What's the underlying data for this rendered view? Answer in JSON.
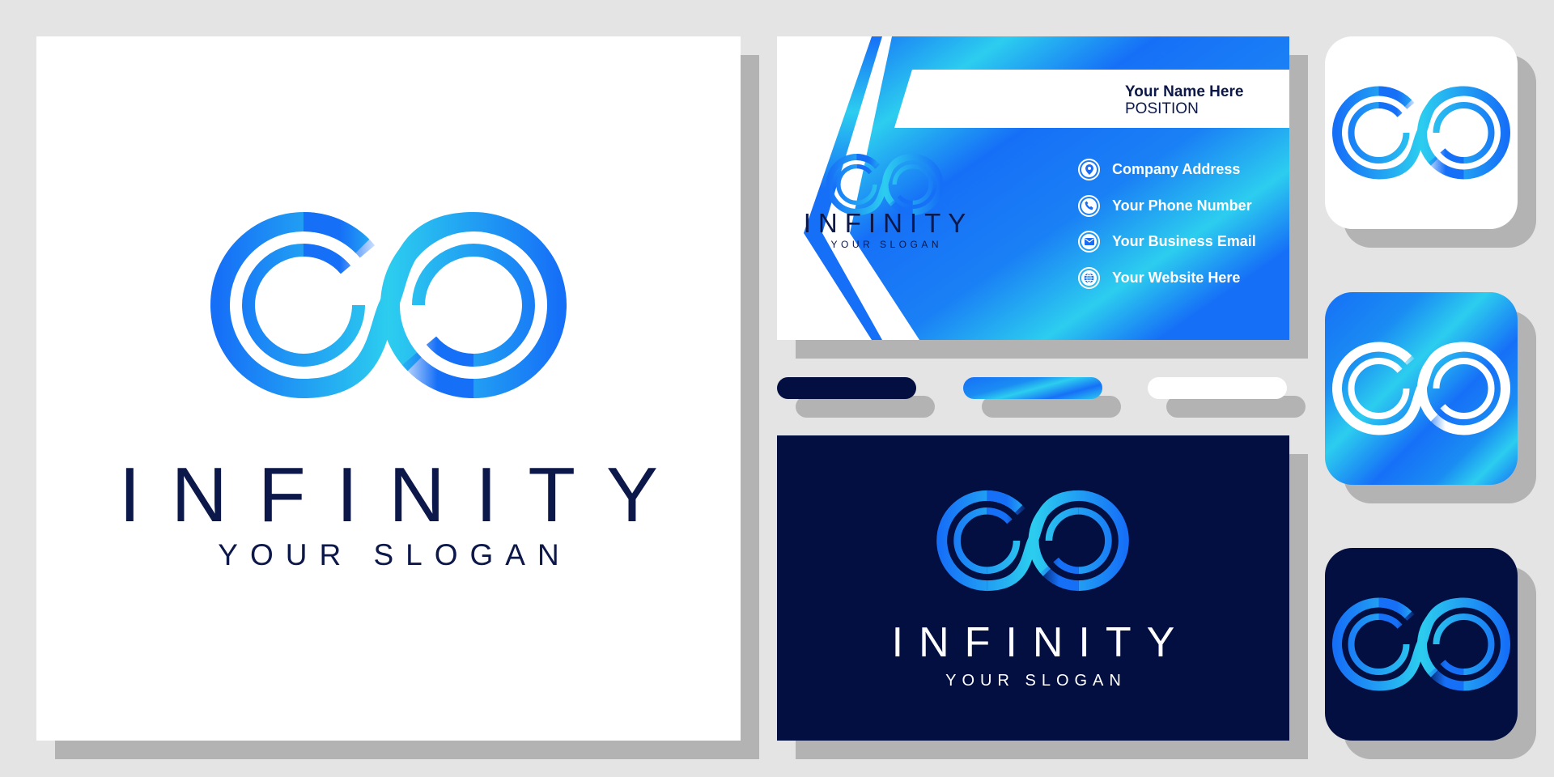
{
  "brand": {
    "name": "INFINITY",
    "slogan": "YOUR SLOGAN"
  },
  "business_card": {
    "name": "Your Name Here",
    "position": "POSITION",
    "contacts": [
      {
        "icon": "location-pin-icon",
        "glyph": "⬤",
        "label": "Company Address"
      },
      {
        "icon": "phone-icon",
        "glyph": "✆",
        "label": "Your Phone Number"
      },
      {
        "icon": "mail-icon",
        "glyph": "✉",
        "label": "Your Business Email"
      },
      {
        "icon": "globe-icon",
        "glyph": "⊕",
        "label": "Your Website Here"
      }
    ]
  },
  "palette": {
    "navy": "#020f40",
    "text_navy": "#0c1849",
    "blue": "#1670f7",
    "cyan": "#2ccdef",
    "background": "#e4e4e4",
    "white": "#ffffff"
  },
  "swatches": [
    "navy",
    "blue-gradient",
    "white"
  ],
  "app_icons": [
    "white",
    "blue-gradient",
    "navy"
  ]
}
